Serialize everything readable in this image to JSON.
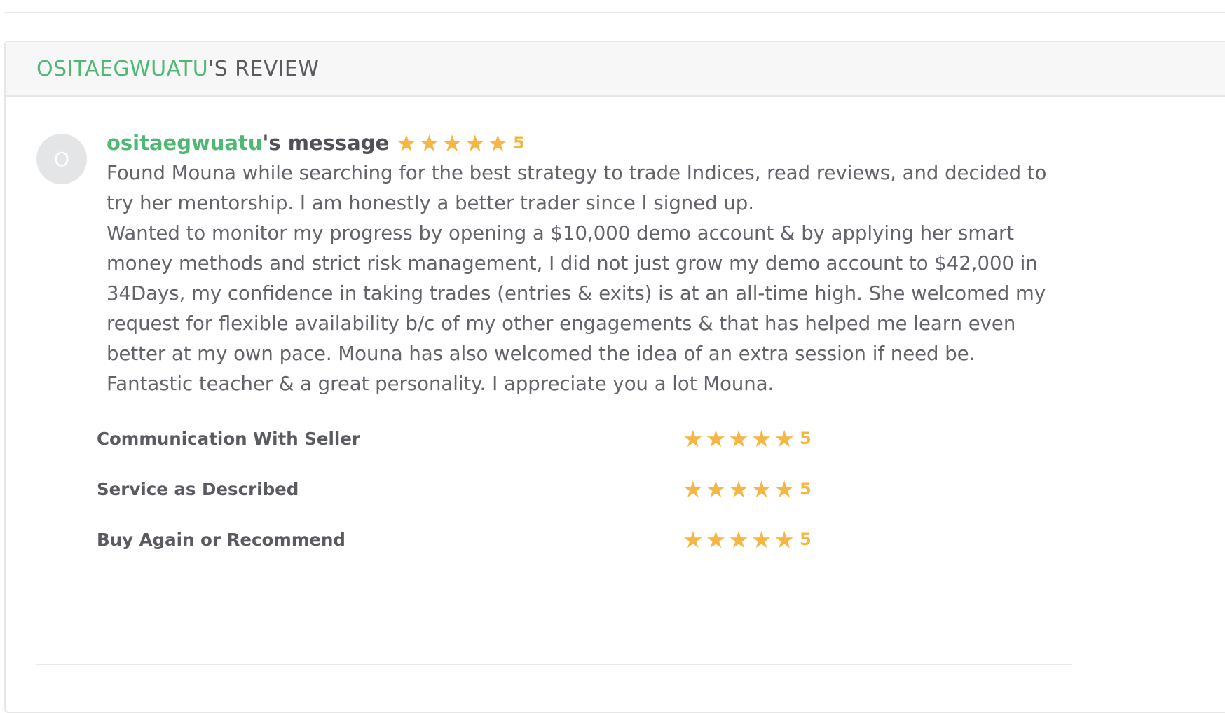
{
  "header": {
    "username": "OSITAEGWUATU",
    "title_suffix": "'S REVIEW"
  },
  "review": {
    "avatar_initial": "O",
    "username": "ositaegwuatu",
    "message_suffix": "'s message",
    "rating": 5,
    "rating_label": "5",
    "paragraphs": [
      "Found Mouna while searching for the best strategy to trade Indices, read reviews, and decided to try her mentorship. I am honestly a better trader since I signed up.",
      "Wanted to monitor my progress by opening a $10,000 demo account & by applying her smart money methods and strict risk management, I did not just grow my demo account to $42,000 in 34Days, my confidence in taking trades (entries & exits) is at an all-time high. She welcomed my request for flexible availability b/c of my other engagements & that has helped me learn even better at my own pace. Mouna has also welcomed the idea of an extra session if need be. Fantastic teacher & a great personality. I appreciate you a lot Mouna."
    ]
  },
  "criteria": [
    {
      "label": "Communication With Seller",
      "rating": 5,
      "rating_label": "5"
    },
    {
      "label": "Service as Described",
      "rating": 5,
      "rating_label": "5"
    },
    {
      "label": "Buy Again or Recommend",
      "rating": 5,
      "rating_label": "5"
    }
  ],
  "colors": {
    "accent_green": "#4fb873",
    "star": "#f6b644",
    "text": "#62646a"
  },
  "icons": {
    "star": "star-icon"
  }
}
